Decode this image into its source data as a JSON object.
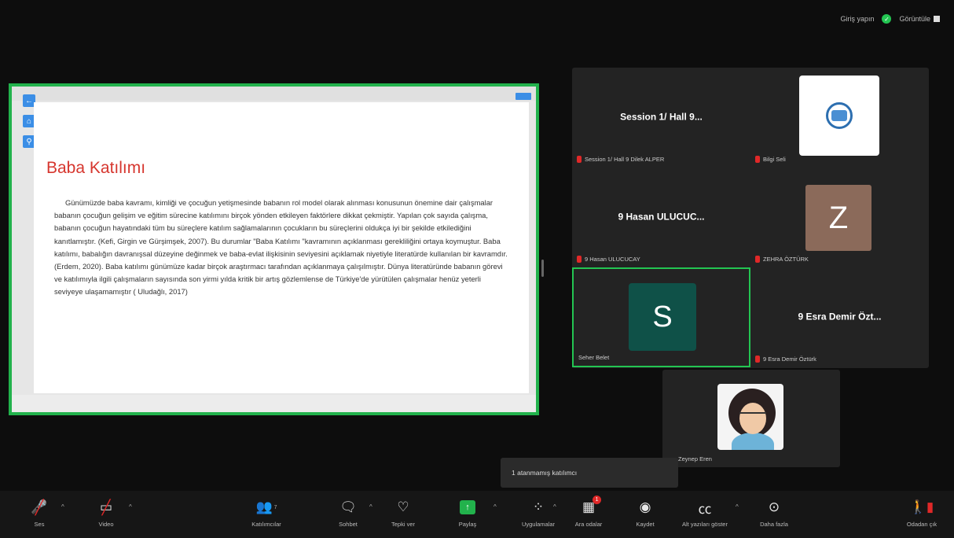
{
  "topbar": {
    "sign_in_label": "Giriş yapın",
    "view_label": "Görüntüle"
  },
  "share": {
    "title": "Baba Katılımı",
    "body": "Günümüzde baba kavramı, kimliği ve çocuğun yetişmesinde babanın rol model olarak alınması konusunun önemine dair çalışmalar babanın çocuğun gelişim ve eğitim sürecine katılımını birçok yönden etkileyen faktörlere dikkat çekmiştir. Yapılan çok sayıda çalışma, babanın çocuğun hayatındaki tüm bu süreçlere katılım sağlamalarının çocukların bu süreçlerini oldukça iyi bir şekilde etkilediğini kanıtlamıştır. (Kefi, Girgin ve Gürşimşek, 2007). Bu durumlar \"Baba Katılımı \"kavramının açıklanması gerekliliğini ortaya koymuştur. Baba katılımı, babalığın davranışsal düzeyine değinmek ve baba-evlat ilişkisinin seviyesini açıklamak niyetiyle literatürde kullanılan bir kavramdır. (Erdem, 2020). Baba katılımı günümüze kadar birçok araştırmacı tarafından açıklanmaya çalışılmıştır. Dünya literatüründe babanın görevi ve katılımıyla ilgili çalışmaların sayısında son yirmi yılda kritik bir artış gözlemlense de Türkiye'de yürütülen çalışmalar henüz yeterli seviyeye ulaşamamıştır ( Uludağlı, 2017)"
  },
  "participants": [
    {
      "display_name": "Session 1/ Hall 9...",
      "label": "Session 1/ Hall 9 Dilek ALPER"
    },
    {
      "display_name": "",
      "label": "Bilgi Seli"
    },
    {
      "display_name": "9 Hasan ULUCUC...",
      "label": "9 Hasan ULUCUCAY"
    },
    {
      "display_name": "Z",
      "label": "ZEHRA ÖZTÜRK"
    },
    {
      "display_name": "S",
      "label": "Seher Belet"
    },
    {
      "display_name": "9 Esra Demir Özt...",
      "label": "9 Esra Demir Öztürk"
    },
    {
      "display_name": "",
      "label": "Zeynep Eren"
    }
  ],
  "tooltip": {
    "text": "1 atanmamış katılımcı"
  },
  "toolbar": {
    "audio_label": "Ses",
    "video_label": "Video",
    "participants_label": "Katılımcılar",
    "participants_count": "7",
    "chat_label": "Sohbet",
    "react_label": "Tepki ver",
    "share_label": "Paylaş",
    "apps_label": "Uygulamalar",
    "breakout_label": "Ara odalar",
    "breakout_badge": "1",
    "record_label": "Kaydet",
    "captions_label": "Alt yazıları göster",
    "more_label": "Daha fazla",
    "leave_label": "Odadan çık"
  },
  "colors": {
    "accent_green": "#22b24c",
    "mute_red": "#e02828",
    "doc_title_red": "#d6362e"
  }
}
